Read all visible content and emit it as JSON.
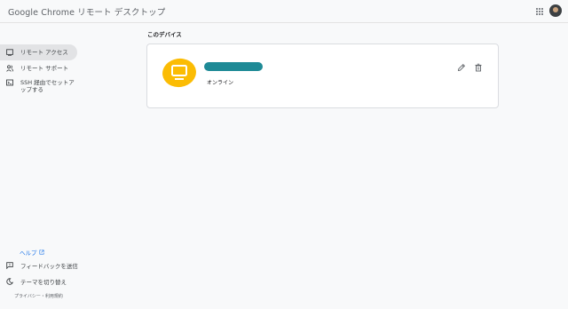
{
  "header": {
    "brand_google": "Google",
    "brand_product": "Chrome リモート デスクトップ",
    "apps_icon": "apps-grid-icon",
    "avatar_icon": "account-avatar"
  },
  "sidebar": {
    "items": [
      {
        "label": "リモート アクセス",
        "icon": "monitor-icon",
        "active": true
      },
      {
        "label": "リモート サポート",
        "icon": "people-icon",
        "active": false
      },
      {
        "label": "SSH 経由でセットアップする",
        "icon": "terminal-icon",
        "active": false
      }
    ],
    "help_label": "ヘルプ",
    "feedback_label": "フィードバックを送信",
    "theme_label": "テーマを切り替え",
    "footer_text": "プライバシー・利用規約"
  },
  "main": {
    "section_title": "このデバイス",
    "device": {
      "status": "オンライン",
      "name_redacted": true,
      "icon": "monitor-icon",
      "accent_color": "#fbbc04",
      "name_bar_color": "#1e8a96"
    },
    "actions": {
      "edit_icon": "pencil-icon",
      "delete_icon": "trash-icon"
    }
  }
}
